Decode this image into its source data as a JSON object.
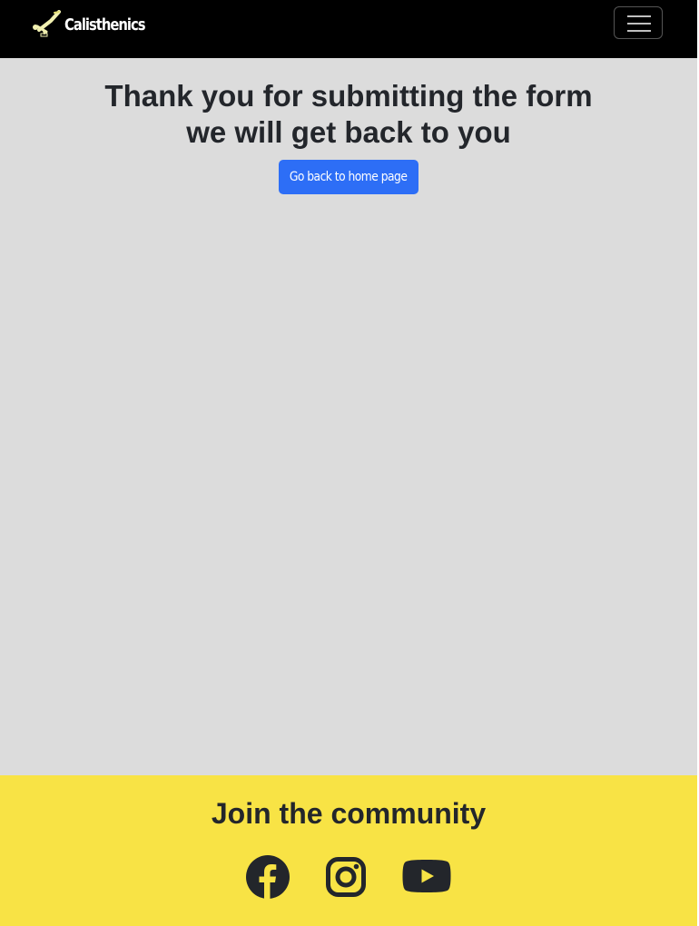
{
  "navbar": {
    "brand": "Calisthenics",
    "brand_icon": "calisthenics-figure-logo",
    "menu_icon": "hamburger-menu-icon"
  },
  "main": {
    "heading_line1": "Thank you for submitting the form",
    "heading_line2": "we will get back to you",
    "button_label": "Go back to home page"
  },
  "footer": {
    "title": "Join the community",
    "social_icons": [
      "facebook-icon",
      "instagram-icon",
      "youtube-icon"
    ]
  },
  "colors": {
    "navbar": "#000000",
    "page_background": "#dcdcdc",
    "button": "#2d6ef6",
    "footer": "#f8e345",
    "text": "#23262b"
  }
}
